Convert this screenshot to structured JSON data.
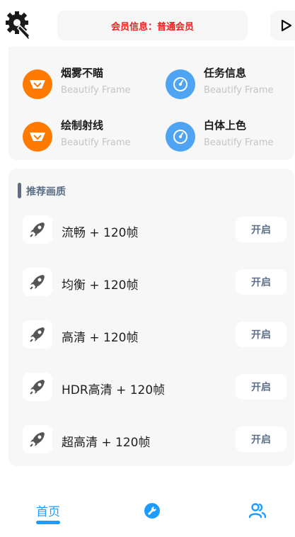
{
  "header": {
    "member_info": "会员信息：普通会员",
    "settings_icon": "gear-wrench-icon",
    "play_icon": "play-icon"
  },
  "features": [
    {
      "title": "烟雾不瞄",
      "subtitle": "Beautify Frame",
      "icon": "orange-badge-icon",
      "color": "#ff7a00"
    },
    {
      "title": "任务信息",
      "subtitle": "Beautify Frame",
      "icon": "speedometer-icon",
      "color": "#4ea4f2"
    },
    {
      "title": "绘制射线",
      "subtitle": "Beautify Frame",
      "icon": "orange-badge-icon",
      "color": "#ff7a00"
    },
    {
      "title": "白体上色",
      "subtitle": "Beautify Frame",
      "icon": "speedometer-icon",
      "color": "#4ea4f2"
    }
  ],
  "quality": {
    "section_title": "推荐画质",
    "items": [
      {
        "label": "流畅 + 120帧",
        "button": "开启",
        "icon": "rocket-icon"
      },
      {
        "label": "均衡 + 120帧",
        "button": "开启",
        "icon": "rocket-icon"
      },
      {
        "label": "高清 + 120帧",
        "button": "开启",
        "icon": "rocket-icon"
      },
      {
        "label": "HDR高清 + 120帧",
        "button": "开启",
        "icon": "rocket-icon"
      },
      {
        "label": "超高清 + 120帧",
        "button": "开启",
        "icon": "rocket-icon"
      }
    ]
  },
  "bottom_nav": {
    "home_label": "首页",
    "tools_icon": "wrench-icon",
    "users_icon": "users-icon"
  },
  "colors": {
    "accent": "#1e9bff",
    "member_red": "#e8221c",
    "slate": "#5c6f86",
    "orange": "#ff7a00",
    "blue": "#4ea4f2"
  }
}
